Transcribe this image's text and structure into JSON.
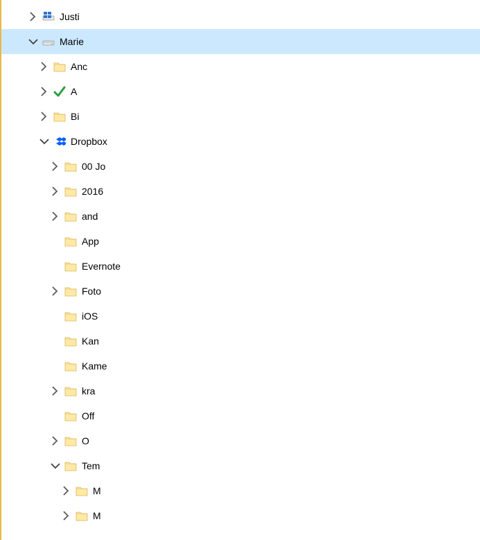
{
  "tree": [
    {
      "depth": 0,
      "chevron": "right",
      "icon": "drive-win",
      "label": "Justi"
    },
    {
      "depth": 0,
      "chevron": "down",
      "icon": "drive",
      "label": "Marie",
      "selected": true
    },
    {
      "depth": 1,
      "chevron": "right",
      "icon": "folder",
      "label": "Anc"
    },
    {
      "depth": 1,
      "chevron": "right",
      "icon": "check",
      "label": "A"
    },
    {
      "depth": 1,
      "chevron": "right",
      "icon": "folder",
      "label": "Bi"
    },
    {
      "depth": 1,
      "chevron": "down",
      "icon": "dropbox",
      "label": "Dropbox"
    },
    {
      "depth": 2,
      "chevron": "right",
      "icon": "folder",
      "label": "00 Jo"
    },
    {
      "depth": 2,
      "chevron": "right",
      "icon": "folder",
      "label": "2016"
    },
    {
      "depth": 2,
      "chevron": "right",
      "icon": "folder",
      "label": "and"
    },
    {
      "depth": 2,
      "chevron": "none",
      "icon": "folder",
      "label": "App"
    },
    {
      "depth": 2,
      "chevron": "none",
      "icon": "folder",
      "label": "Evernote"
    },
    {
      "depth": 2,
      "chevron": "right",
      "icon": "folder",
      "label": "Foto"
    },
    {
      "depth": 2,
      "chevron": "none",
      "icon": "folder",
      "label": "iOS"
    },
    {
      "depth": 2,
      "chevron": "none",
      "icon": "folder",
      "label": "Kan"
    },
    {
      "depth": 2,
      "chevron": "none",
      "icon": "folder",
      "label": "Kame"
    },
    {
      "depth": 2,
      "chevron": "right",
      "icon": "folder",
      "label": "kra"
    },
    {
      "depth": 2,
      "chevron": "none",
      "icon": "folder",
      "label": "Off"
    },
    {
      "depth": 2,
      "chevron": "right",
      "icon": "folder",
      "label": "O"
    },
    {
      "depth": 2,
      "chevron": "down",
      "icon": "folder",
      "label": "Tem"
    },
    {
      "depth": 3,
      "chevron": "right",
      "icon": "folder",
      "label": "M"
    },
    {
      "depth": 3,
      "chevron": "right",
      "icon": "folder",
      "label": "M"
    }
  ],
  "indent_base": 38,
  "indent_step": 16
}
